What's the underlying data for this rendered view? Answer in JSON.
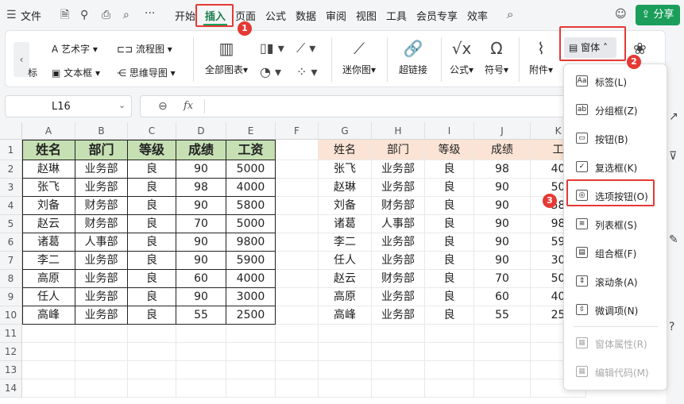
{
  "menubar": {
    "file_label": "文件",
    "tabs": [
      "开始",
      "插入",
      "页面",
      "公式",
      "数据",
      "审阅",
      "视图",
      "工具",
      "会员专享",
      "效率"
    ],
    "share_label": "分享",
    "active_tab": "插入"
  },
  "ribbon": {
    "art_text": "艺术字",
    "flowchart": "流程图",
    "text_box": "文本框",
    "mindmap": "思维导图",
    "label_partial": "标",
    "all_charts": "全部图表",
    "sparkline": "迷你图",
    "hyperlink": "超链接",
    "formula": "公式",
    "symbol": "符号",
    "attachment": "附件",
    "form": "窗体"
  },
  "formula_bar": {
    "cell_ref": "L16",
    "fx": "fx"
  },
  "sheet": {
    "columns": [
      "A",
      "B",
      "C",
      "D",
      "E",
      "F",
      "G",
      "H",
      "I",
      "J",
      "K"
    ],
    "rows": [
      "1",
      "2",
      "3",
      "4",
      "5",
      "6",
      "7",
      "8",
      "9",
      "10",
      "11",
      "12",
      "13",
      "14"
    ],
    "left_header": [
      "姓名",
      "部门",
      "等级",
      "成绩",
      "工资"
    ],
    "left_data": [
      [
        "赵琳",
        "业务部",
        "良",
        "90",
        "5000"
      ],
      [
        "张飞",
        "业务部",
        "良",
        "98",
        "4000"
      ],
      [
        "刘备",
        "财务部",
        "良",
        "90",
        "5800"
      ],
      [
        "赵云",
        "财务部",
        "良",
        "70",
        "5000"
      ],
      [
        "诸葛",
        "人事部",
        "良",
        "90",
        "9800"
      ],
      [
        "李二",
        "业务部",
        "良",
        "90",
        "5900"
      ],
      [
        "高原",
        "业务部",
        "良",
        "60",
        "4000"
      ],
      [
        "任人",
        "业务部",
        "良",
        "90",
        "3000"
      ],
      [
        "高峰",
        "业务部",
        "良",
        "55",
        "2500"
      ]
    ],
    "right_header": [
      "姓名",
      "部门",
      "等级",
      "成绩",
      "工"
    ],
    "right_data": [
      [
        "张飞",
        "业务部",
        "良",
        "98",
        "40"
      ],
      [
        "赵琳",
        "业务部",
        "良",
        "90",
        "50"
      ],
      [
        "刘备",
        "财务部",
        "良",
        "90",
        "58"
      ],
      [
        "诸葛",
        "人事部",
        "良",
        "90",
        "98"
      ],
      [
        "李二",
        "业务部",
        "良",
        "90",
        "59"
      ],
      [
        "任人",
        "业务部",
        "良",
        "90",
        "30"
      ],
      [
        "赵云",
        "财务部",
        "良",
        "70",
        "50"
      ],
      [
        "高原",
        "业务部",
        "良",
        "60",
        "40"
      ],
      [
        "高峰",
        "业务部",
        "良",
        "55",
        "25"
      ]
    ]
  },
  "dropdown": {
    "items": [
      {
        "label": "标签(L)",
        "icon": "Aa",
        "enabled": true
      },
      {
        "label": "分组框(Z)",
        "icon": "ab",
        "enabled": true
      },
      {
        "label": "按钮(B)",
        "icon": "▭",
        "enabled": true
      },
      {
        "label": "复选框(K)",
        "icon": "✓",
        "enabled": true
      },
      {
        "label": "选项按钮(O)",
        "icon": "◎",
        "enabled": true
      },
      {
        "label": "列表框(S)",
        "icon": "≡",
        "enabled": true
      },
      {
        "label": "组合框(F)",
        "icon": "▤",
        "enabled": true
      },
      {
        "label": "滚动条(A)",
        "icon": "⇕",
        "enabled": true
      },
      {
        "label": "微调项(N)",
        "icon": "⇳",
        "enabled": true
      },
      {
        "label": "窗体属性(R)",
        "icon": "▦",
        "enabled": false
      },
      {
        "label": "编辑代码(M)",
        "icon": "▦",
        "enabled": false
      }
    ]
  },
  "badges": [
    "1",
    "2",
    "3"
  ],
  "colors": {
    "accent": "#1a9e5a",
    "left_header_bg": "#c6e0b4",
    "right_header_bg": "#fbe4d5",
    "highlight": "#e53935"
  }
}
